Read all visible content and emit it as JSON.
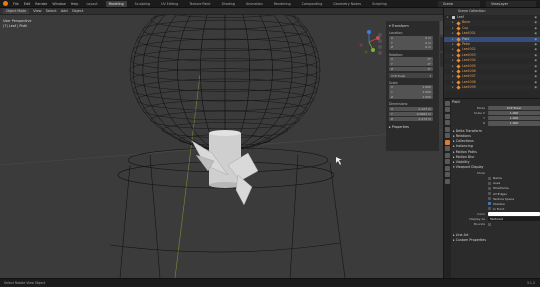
{
  "topbar": {
    "menus": [
      "File",
      "Edit",
      "Render",
      "Window",
      "Help"
    ],
    "tabs": [
      "Layout",
      "Modeling",
      "Sculpting",
      "UV Editing",
      "Texture Paint",
      "Shading",
      "Animation",
      "Rendering",
      "Compositing",
      "Geometry Nodes",
      "Scripting"
    ],
    "active_tab": "Modeling",
    "scene": "Scene",
    "view_layer": "ViewLayer"
  },
  "viewport_header": {
    "mode": "Object Mode",
    "menus": [
      "View",
      "Select",
      "Add",
      "Object"
    ]
  },
  "viewport": {
    "view_name": "User Perspective",
    "collection": "(7) Leaf | Pistil"
  },
  "npanel": {
    "transform_title": "Transform",
    "location_label": "Location:",
    "location": [
      {
        "axis": "X",
        "value": "0 m"
      },
      {
        "axis": "Y",
        "value": "0 m"
      },
      {
        "axis": "Z",
        "value": "0 m"
      }
    ],
    "rotation_label": "Rotation:",
    "rotation": [
      {
        "axis": "X",
        "value": "0°"
      },
      {
        "axis": "Y",
        "value": "0°"
      },
      {
        "axis": "Z",
        "value": "0°"
      }
    ],
    "rotation_mode": "XYZ Euler",
    "scale_label": "Scale:",
    "scale": [
      {
        "axis": "X",
        "value": "1.000"
      },
      {
        "axis": "Y",
        "value": "1.000"
      },
      {
        "axis": "Z",
        "value": "1.000"
      }
    ],
    "dimensions_label": "Dimensions:",
    "dimensions": [
      {
        "axis": "X",
        "value": "0.127 m"
      },
      {
        "axis": "Y",
        "value": "0.0662 m"
      },
      {
        "axis": "Z",
        "value": "0.173 m"
      }
    ],
    "properties_title": "Properties",
    "tabs": [
      "Item",
      "Tool",
      "View"
    ]
  },
  "outliner": {
    "title": "Scene Collection",
    "rows": [
      {
        "name": "Leaf",
        "type": "collection",
        "orange": false,
        "selected": false
      },
      {
        "name": "Bone",
        "type": "object",
        "orange": true,
        "selected": false
      },
      {
        "name": "Cup",
        "type": "object",
        "orange": true,
        "selected": false
      },
      {
        "name": "Leaf.001",
        "type": "object",
        "orange": true,
        "selected": false
      },
      {
        "name": "Pistil",
        "type": "object",
        "orange": false,
        "selected": true
      },
      {
        "name": "Petal",
        "type": "object",
        "orange": true,
        "selected": false
      },
      {
        "name": "Leaf.002",
        "type": "object",
        "orange": true,
        "selected": false
      },
      {
        "name": "Leaf.003",
        "type": "object",
        "orange": true,
        "selected": false
      },
      {
        "name": "Leaf.004",
        "type": "object",
        "orange": true,
        "selected": false
      },
      {
        "name": "Leaf.005",
        "type": "object",
        "orange": true,
        "selected": false
      },
      {
        "name": "Leaf.006",
        "type": "object",
        "orange": true,
        "selected": false
      },
      {
        "name": "Leaf.007",
        "type": "object",
        "orange": true,
        "selected": false
      },
      {
        "name": "Leaf.008",
        "type": "object",
        "orange": true,
        "selected": false
      },
      {
        "name": "Leaf.009",
        "type": "object",
        "orange": true,
        "selected": false
      }
    ]
  },
  "properties": {
    "object_name": "Pistil",
    "mode_label": "Mode",
    "mode_value": "XYZ Euler",
    "scale_label": "Scale X",
    "scale": [
      {
        "label": "Scale X",
        "value": "1.000"
      },
      {
        "label": "Y",
        "value": "1.000"
      },
      {
        "label": "Z",
        "value": "1.000"
      }
    ],
    "panels_top": [
      "Delta Transform",
      "Relations",
      "Collections",
      "Instancing",
      "Motion Paths",
      "Motion Blur",
      "Visibility",
      "Viewport Display"
    ],
    "show_label": "Show",
    "checks": [
      {
        "label": "Name",
        "on": false
      },
      {
        "label": "Axes",
        "on": false
      },
      {
        "label": "Wireframe",
        "on": false
      },
      {
        "label": "All Edges",
        "on": false
      },
      {
        "label": "Texture Space",
        "on": false
      },
      {
        "label": "Shadow",
        "on": true
      },
      {
        "label": "In Front",
        "on": false
      }
    ],
    "color_label": "Color",
    "display_as_label": "Display As",
    "display_as_value": "Textured",
    "bounds_label": "Bounds",
    "panels_bottom": [
      "Line Art",
      "Custom Properties"
    ]
  },
  "status": {
    "left": "Select     Rotate View     Object",
    "right": "3.1.2"
  },
  "colors": {
    "accent": "#e87d0d",
    "selection": "#334d80",
    "checkbox_on": "#4772b3"
  }
}
